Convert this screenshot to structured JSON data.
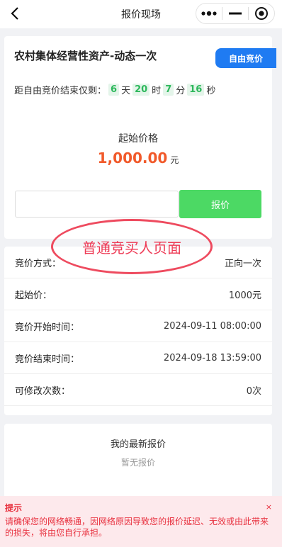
{
  "header": {
    "title": "报价现场"
  },
  "auction": {
    "title": "农村集体经营性资产-动态一次",
    "mode_button": "自由竞价",
    "countdown": {
      "prefix": "距自由竞价结束仅剩：",
      "days": "6",
      "days_unit": "天",
      "hours": "20",
      "hours_unit": "时",
      "minutes": "7",
      "minutes_unit": "分",
      "seconds": "16",
      "seconds_unit": "秒"
    },
    "start_price_label": "起始价格",
    "start_price": "1,000.00",
    "start_price_unit": "元",
    "bid_input_value": "",
    "bid_button": "报价"
  },
  "annotation": {
    "text": "普通竞买人页面"
  },
  "details": [
    {
      "label": "竞价方式：",
      "value": "正向一次"
    },
    {
      "label": "起始价：",
      "value": "1000元"
    },
    {
      "label": "竞价开始时间：",
      "value": "2024-09-11 08:00:00"
    },
    {
      "label": "竞价结束时间：",
      "value": "2024-09-18 13:59:00"
    },
    {
      "label": "可修改次数：",
      "value": "0次"
    }
  ],
  "latest": {
    "title": "我的最新报价",
    "empty": "暂无报价"
  },
  "notice": {
    "title": "提示",
    "text": "请确保您的网络畅通，因网络原因导致您的报价延迟、无效或由此带来的损失，将由您自行承担。",
    "close": "×"
  },
  "colors": {
    "accent_blue": "#1f7bf2",
    "bid_green": "#4cd964",
    "price_orange": "#f15a2b",
    "notice_red": "#e8313f"
  }
}
